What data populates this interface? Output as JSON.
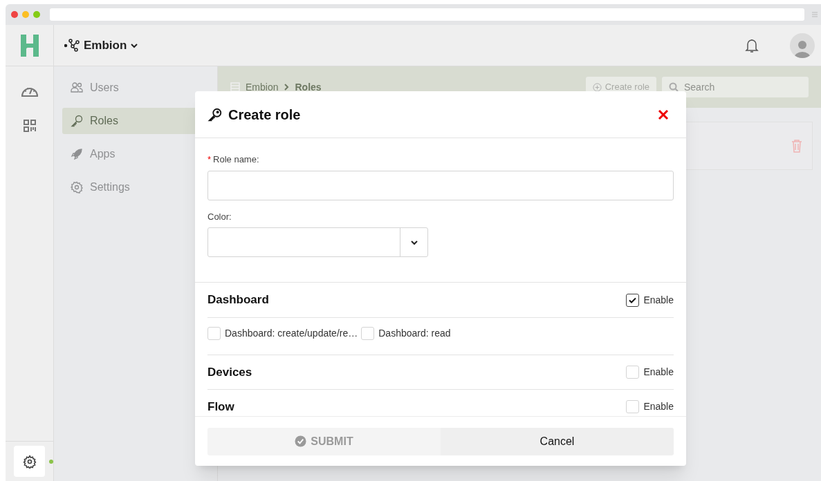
{
  "header": {
    "workspace": "Embion"
  },
  "sidebar": {
    "items": [
      {
        "label": "Users",
        "selected": false
      },
      {
        "label": "Roles",
        "selected": true
      },
      {
        "label": "Apps",
        "selected": false
      },
      {
        "label": "Settings",
        "selected": false
      }
    ]
  },
  "breadcrumb": [
    "Embion",
    "Roles"
  ],
  "toolbar": {
    "create_button": "Create role",
    "search": {
      "placeholder": "Search"
    }
  },
  "modal": {
    "title": "Create role",
    "fields": [
      {
        "kind": "text",
        "label": "Role name:",
        "required": true,
        "required_mark": "*"
      },
      {
        "kind": "select",
        "label": "Color:",
        "required": false
      }
    ],
    "sections": [
      {
        "title": "Dashboard",
        "enable_label": "Enable",
        "enabled": true,
        "permissions": [
          {
            "label": "Dashboard: create/update/re…",
            "checked": false
          },
          {
            "label": "Dashboard: read",
            "checked": false
          }
        ]
      },
      {
        "title": "Devices",
        "enable_label": "Enable",
        "enabled": false
      },
      {
        "title": "Flow",
        "enable_label": "Enable",
        "enabled": false
      }
    ],
    "submit": {
      "label": "SUBMIT",
      "disabled": true
    },
    "cancel": "Cancel"
  }
}
